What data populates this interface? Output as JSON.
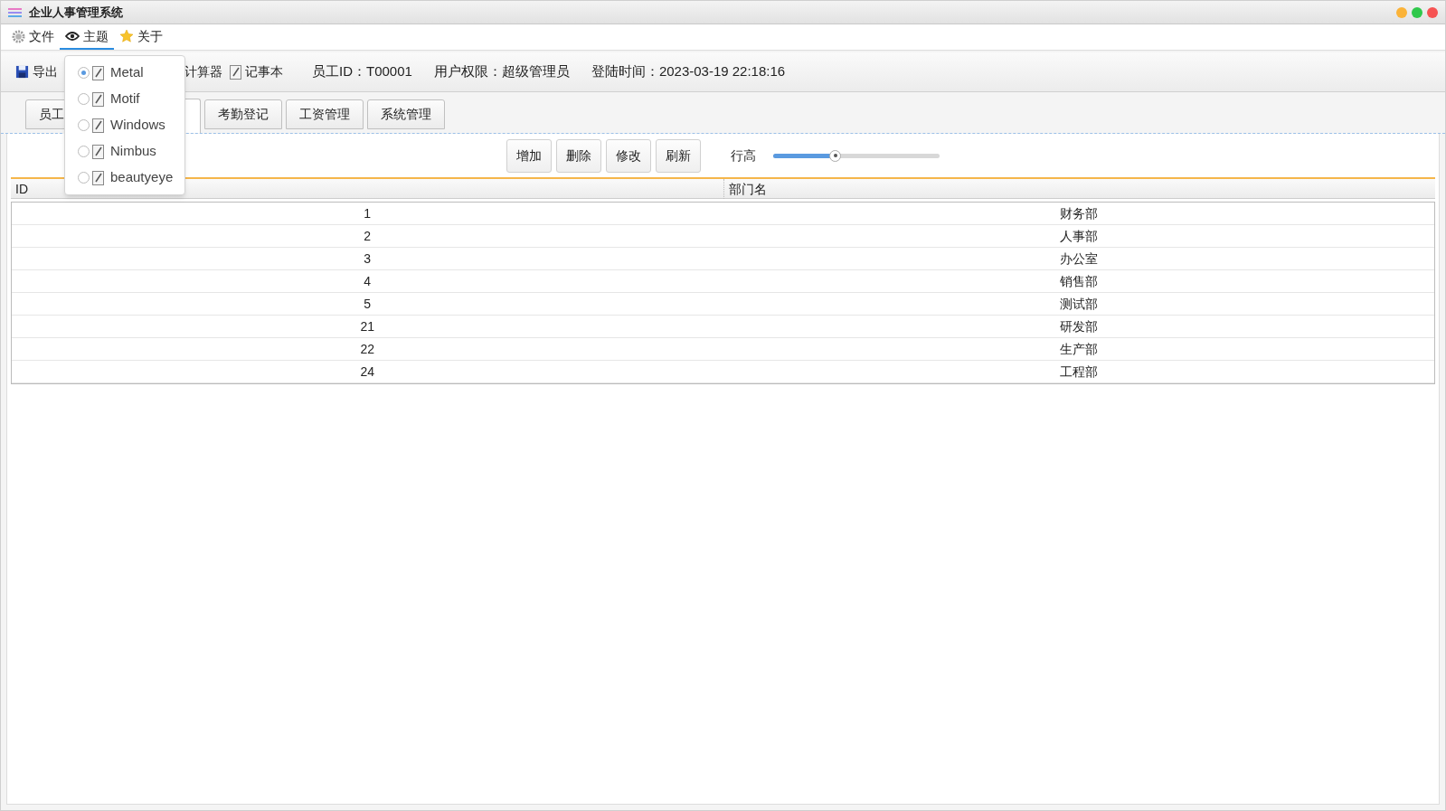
{
  "window": {
    "title": "企业人事管理系统"
  },
  "menu": [
    {
      "label": "文件",
      "selected": false
    },
    {
      "label": "主题",
      "selected": true
    },
    {
      "label": "关于",
      "selected": false
    }
  ],
  "theme_menu": [
    {
      "label": "Metal",
      "selected": true
    },
    {
      "label": "Motif",
      "selected": false
    },
    {
      "label": "Windows",
      "selected": false
    },
    {
      "label": "Nimbus",
      "selected": false
    },
    {
      "label": "beautyeye",
      "selected": false
    }
  ],
  "toolbar": [
    "导出",
    "计算器",
    "记事本"
  ],
  "status": [
    "员工ID：T00001",
    "用户权限：超级管理员",
    "登陆时间：2023-03-19 22:18:16"
  ],
  "tabs": [
    {
      "label": "员工",
      "selected": false
    },
    {
      "selected": true
    },
    {
      "label": "考勤登记",
      "selected": false
    },
    {
      "label": "工资管理",
      "selected": false
    },
    {
      "label": "系统管理",
      "selected": false
    }
  ],
  "actions": [
    "增加",
    "删除",
    "修改",
    "刷新"
  ],
  "row_height": {
    "label": "行高",
    "level": 0.37
  },
  "table": {
    "columns": [
      "ID",
      "部门名"
    ],
    "rows": [
      [
        "1",
        "财务部"
      ],
      [
        "2",
        "人事部"
      ],
      [
        "3",
        "办公室"
      ],
      [
        "4",
        "销售部"
      ],
      [
        "5",
        "测试部"
      ],
      [
        "21",
        "研发部"
      ],
      [
        "22",
        "生产部"
      ],
      [
        "24",
        "工程部"
      ]
    ]
  }
}
